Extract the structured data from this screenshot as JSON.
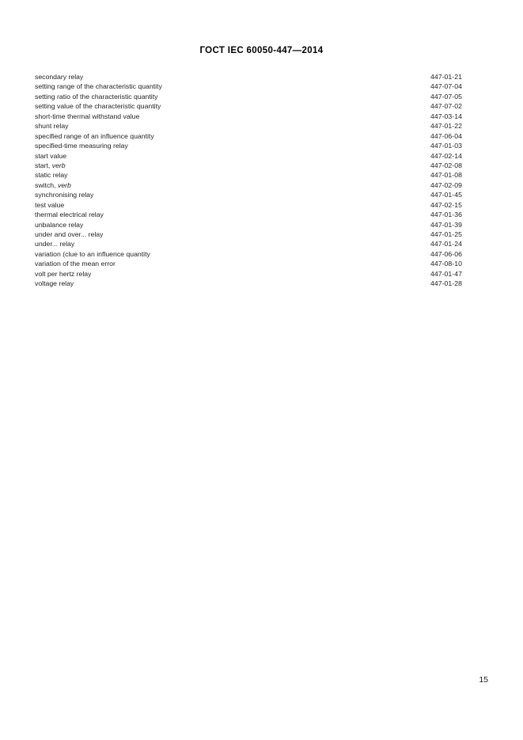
{
  "document": {
    "header": "ГОСТ IEC 60050-447—2014",
    "page_number": "15"
  },
  "index": {
    "entries": [
      {
        "term": "secondary relay",
        "code": "447-01-21"
      },
      {
        "term": "setting range of the characteristic quantity",
        "code": "447-07-04"
      },
      {
        "term": "setting ratio of the characteristic quantity",
        "code": "447-07-05"
      },
      {
        "term": "setting value of the characteristic quantity",
        "code": "447-07-02"
      },
      {
        "term": "short-time thermal withstand value",
        "code": "447-03-14"
      },
      {
        "term": "shunt relay",
        "code": "447-01-22"
      },
      {
        "term": "specified range of an influence quantity",
        "code": "447-06-04"
      },
      {
        "term": "specified-time measuring relay",
        "code": "447-01-03"
      },
      {
        "term": "start value",
        "code": "447-02-14"
      },
      {
        "term": "start, ",
        "term_italic": "verb",
        "code": "447-02-08"
      },
      {
        "term": "static relay",
        "code": "447-01-08"
      },
      {
        "term": "switch, ",
        "term_italic": "verb",
        "code": "447-02-09"
      },
      {
        "term": "synchronising relay",
        "code": "447-01-45"
      },
      {
        "term": "test value",
        "code": "447-02-15"
      },
      {
        "term": "thermal electrical relay",
        "code": "447-01-36"
      },
      {
        "term": "unbalance relay",
        "code": "447-01-39"
      },
      {
        "term": "under and over... relay",
        "code": "447-01-25"
      },
      {
        "term": "under... relay",
        "code": "447-01-24"
      },
      {
        "term": "variation (clue to an influence quantity",
        "code": "447-06-06"
      },
      {
        "term": "variation of the mean error",
        "code": "447-08-10"
      },
      {
        "term": "volt per hertz relay",
        "code": "447-01-47"
      },
      {
        "term": "voltage relay",
        "code": "447-01-28"
      }
    ]
  }
}
